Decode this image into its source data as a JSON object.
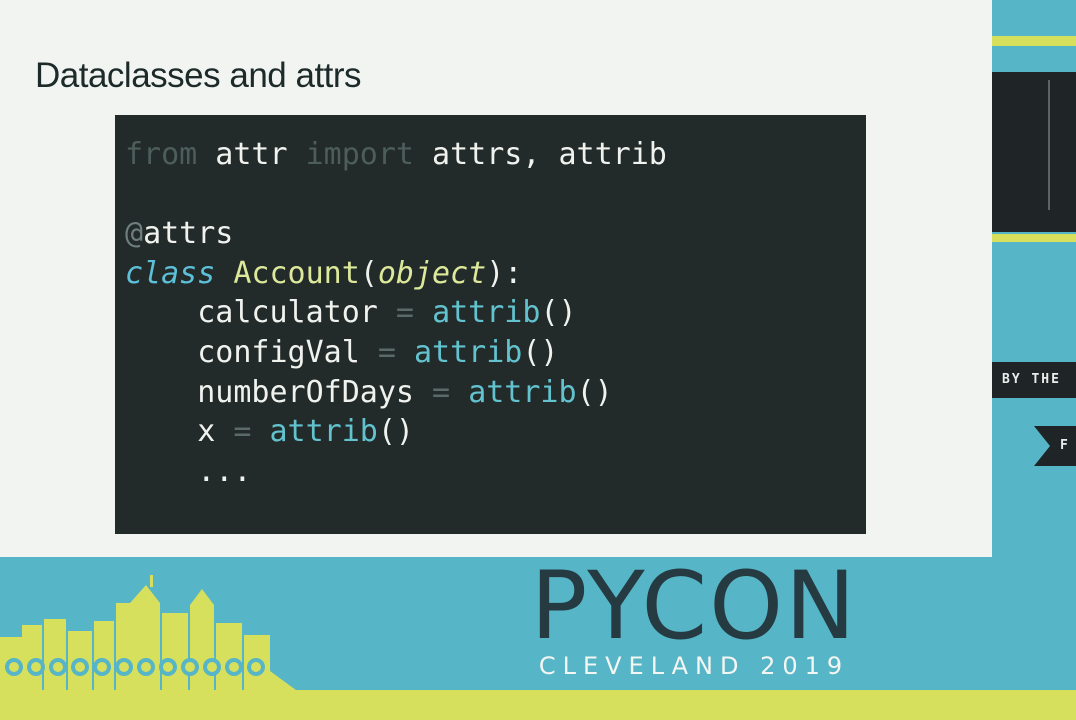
{
  "slide": {
    "title": "Dataclasses and attrs"
  },
  "code": {
    "line1": {
      "kw_from": "from",
      "module": " attr ",
      "kw_import": "import",
      "names": " attrs, attrib"
    },
    "line3": {
      "at": "@",
      "decorator": "attrs"
    },
    "line4": {
      "kw_class": "class",
      "space": " ",
      "class_name": "Account",
      "open": "(",
      "base": "object",
      "close": "):"
    },
    "fields": [
      {
        "indent": "    ",
        "name": "calculator",
        "eq": " = ",
        "call": "attrib",
        "parens": "()"
      },
      {
        "indent": "    ",
        "name": "configVal",
        "eq": " = ",
        "call": "attrib",
        "parens": "()"
      },
      {
        "indent": "    ",
        "name": "numberOfDays",
        "eq": " = ",
        "call": "attrib",
        "parens": "()"
      },
      {
        "indent": "    ",
        "name": "x",
        "eq": " = ",
        "call": "attrib",
        "parens": "()"
      }
    ],
    "ellipsis": "    ..."
  },
  "branding": {
    "logo_text": "PYCON",
    "subtitle": "CLEVELAND 2019",
    "side_tag_1": "BY THE",
    "side_tag_2": "F"
  },
  "colors": {
    "slide_bg": "#f1f4f1",
    "code_bg": "#222a2a",
    "banner_teal": "#56b5c6",
    "accent_yellow": "#d7e05c",
    "logo_dark": "#263a42"
  }
}
